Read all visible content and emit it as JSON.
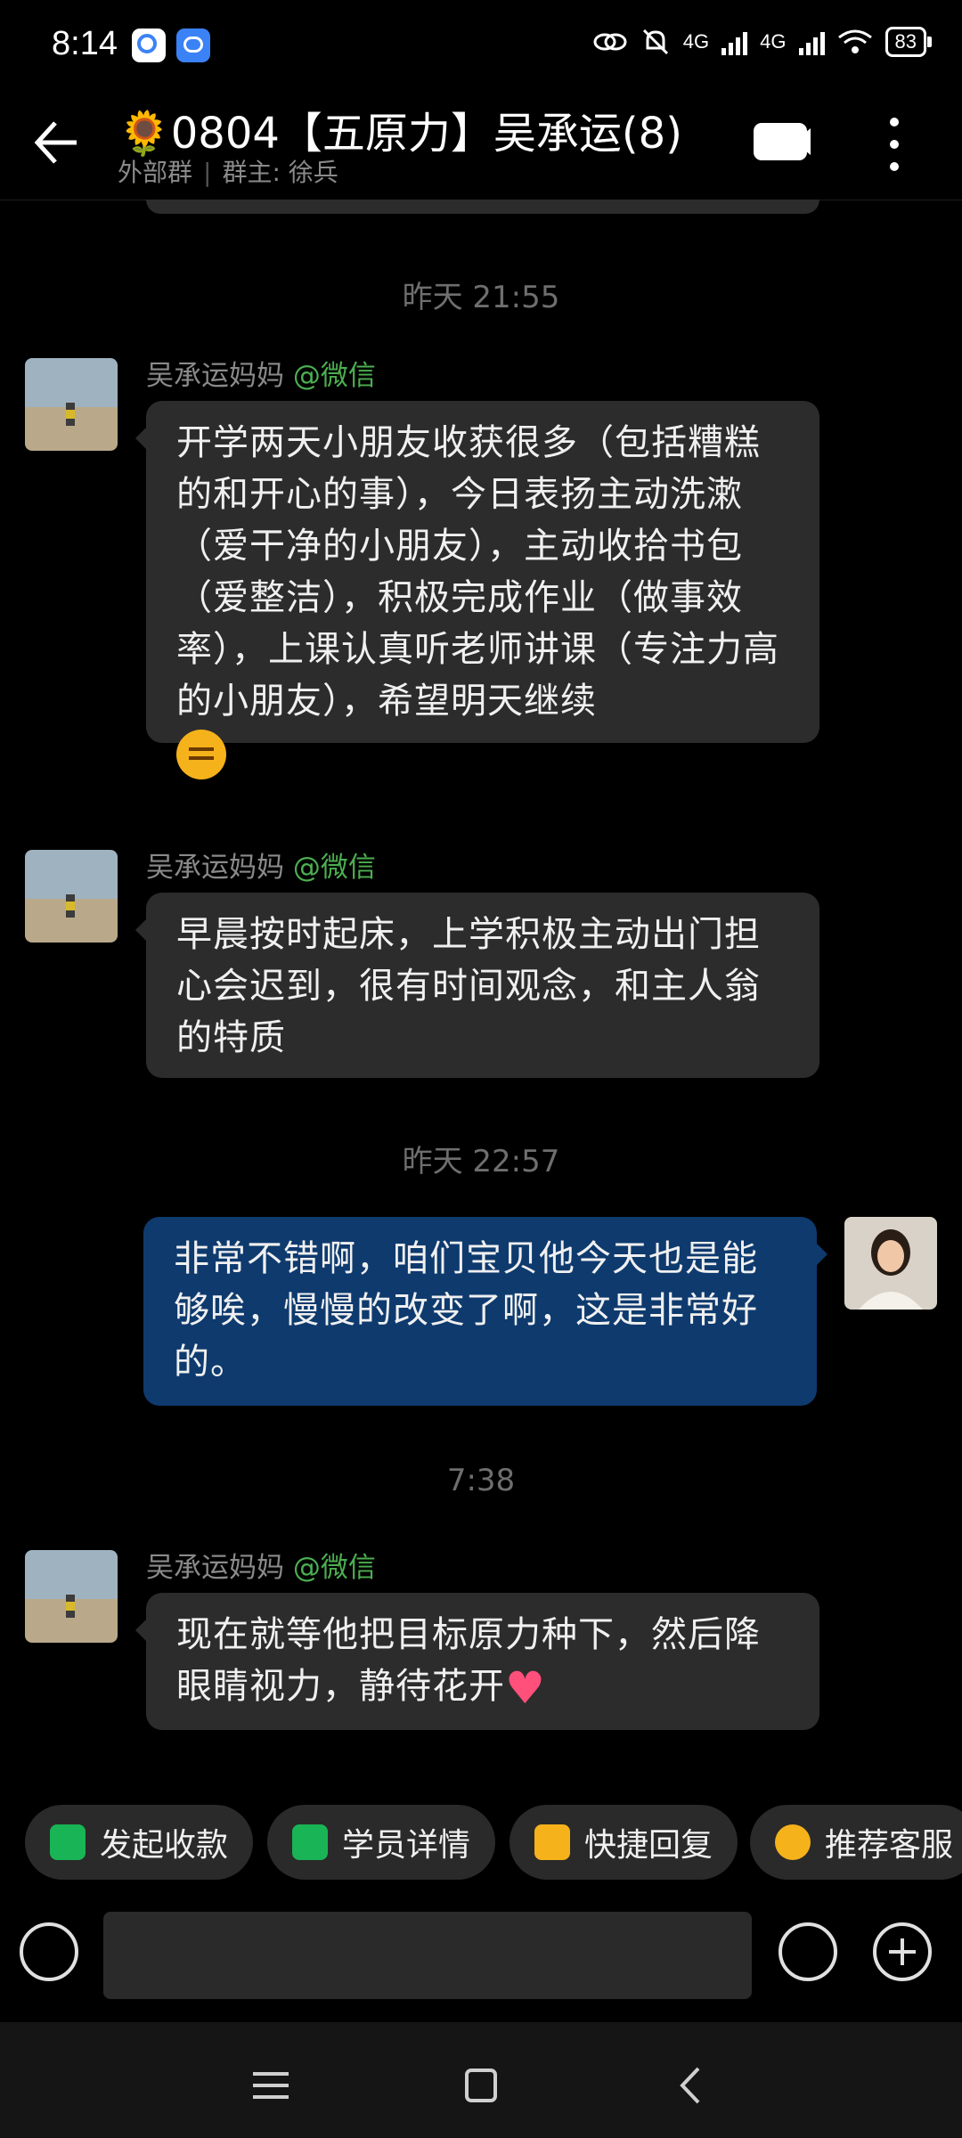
{
  "status_bar": {
    "time": "8:14",
    "net1": "4G",
    "net2": "4G",
    "battery": "83"
  },
  "header": {
    "title": "🌻0804【五原力】吴承运(8)",
    "group_type": "外部群",
    "owner": "群主: 徐兵"
  },
  "messages": [
    {
      "type": "time",
      "text": "昨天  21:55"
    },
    {
      "type": "incoming",
      "sender": "吴承运妈妈",
      "tag": "@微信",
      "text": "开学两天小朋友收获很多（包括糟糕的和开心的事），今日表扬主动洗漱（爱干净的小朋友），主动收拾书包（爱整洁），积极完成作业（做事效率），上课认真听老师讲课（专注力高的小朋友），希望明天继续",
      "emoji": "shushing-face"
    },
    {
      "type": "incoming",
      "sender": "吴承运妈妈",
      "tag": "@微信",
      "text": "早晨按时起床，上学积极主动出门担心会迟到，很有时间观念，和主人翁的特质"
    },
    {
      "type": "time",
      "text": "昨天  22:57"
    },
    {
      "type": "outgoing",
      "text": "非常不错啊，咱们宝贝他今天也是能够唉，慢慢的改变了啊，这是非常好的。"
    },
    {
      "type": "time",
      "text": "7:38"
    },
    {
      "type": "incoming",
      "sender": "吴承运妈妈",
      "tag": "@微信",
      "text": "现在就等他把目标原力种下，然后降眼睛视力，静待花开",
      "emoji": "heart"
    }
  ],
  "quick_actions": [
    {
      "label": "发起收款",
      "icon": "payment-shield-icon",
      "color": "#19b455"
    },
    {
      "label": "学员详情",
      "icon": "student-card-icon",
      "color": "#19b455"
    },
    {
      "label": "快捷回复",
      "icon": "quick-reply-icon",
      "color": "#f5b21b"
    },
    {
      "label": "推荐客服",
      "icon": "customer-service-icon",
      "color": "#f5b21b"
    }
  ],
  "colors": {
    "outgoing_bubble": "#0e3a6e",
    "incoming_bubble": "#2c2c2c",
    "tag": "#4caf50"
  }
}
